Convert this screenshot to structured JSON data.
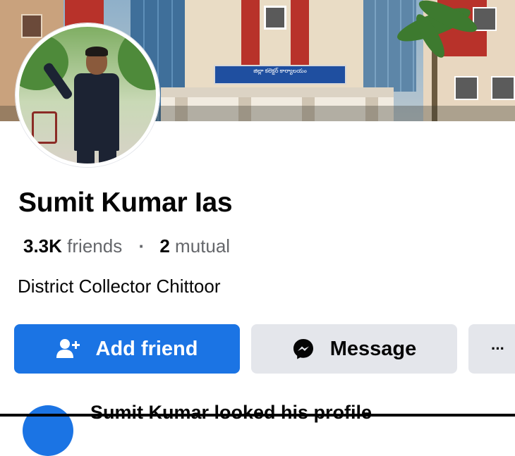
{
  "cover": {
    "signboard_text": "జిల్లా కలెక్టర్ కార్యాలయం"
  },
  "profile": {
    "name": "Sumit Kumar Ias",
    "friends_count": "3.3K",
    "friends_label": "friends",
    "separator": "·",
    "mutual_count": "2",
    "mutual_label": "mutual",
    "bio": "District Collector Chittoor"
  },
  "actions": {
    "add_friend_label": "Add friend",
    "message_label": "Message",
    "more_label": "···"
  },
  "feed": {
    "first_item_text": "Sumit Kumar looked his profile"
  },
  "colors": {
    "primary_button": "#1b74e4",
    "secondary_button": "#e4e6eb",
    "secondary_text": "#65676b"
  },
  "icons": [
    "add-friend-icon",
    "messenger-icon",
    "more-icon"
  ]
}
